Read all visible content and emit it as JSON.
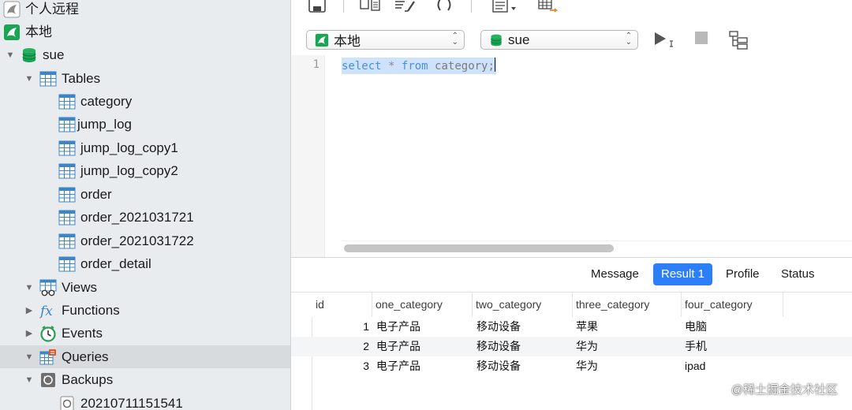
{
  "sidebar": {
    "connections": [
      {
        "label": "个人远程",
        "icon": "mysql-connection-icon"
      },
      {
        "label": "本地",
        "icon": "mysql-connection-icon"
      }
    ],
    "database": {
      "label": "sue",
      "icon": "database-icon"
    },
    "tables_group": {
      "label": "Tables"
    },
    "tables": [
      "category",
      "jump_log",
      "jump_log_copy1",
      "jump_log_copy2",
      "order",
      "order_2021031721",
      "order_2021031722",
      "order_detail"
    ],
    "views": {
      "label": "Views"
    },
    "functions": {
      "label": "Functions"
    },
    "events": {
      "label": "Events"
    },
    "queries": {
      "label": "Queries"
    },
    "backups": {
      "label": "Backups"
    },
    "backup_items": [
      "20210711151541"
    ]
  },
  "selectors": {
    "connection": "本地",
    "database": "sue"
  },
  "editor": {
    "line_number": "1",
    "tokens": {
      "kw1": "select",
      "star": "*",
      "kw2": "from",
      "table": "category;"
    }
  },
  "tabs": [
    {
      "label": "Message"
    },
    {
      "label": "Result 1",
      "active": true
    },
    {
      "label": "Profile"
    },
    {
      "label": "Status"
    }
  ],
  "result": {
    "columns": [
      "id",
      "one_category",
      "two_category",
      "three_category",
      "four_category"
    ],
    "rows": [
      [
        "1",
        "电子产品",
        "移动设备",
        "苹果",
        "电脑"
      ],
      [
        "2",
        "电子产品",
        "移动设备",
        "华为",
        "手机"
      ],
      [
        "3",
        "电子产品",
        "移动设备",
        "华为",
        "ipad"
      ]
    ]
  },
  "watermark": "@稀土掘金技术社区",
  "colors": {
    "accent": "#2d7ff9",
    "mysql_green": "#1aa554",
    "table_blue": "#3d85c6",
    "selection": "#cfe2fb"
  }
}
